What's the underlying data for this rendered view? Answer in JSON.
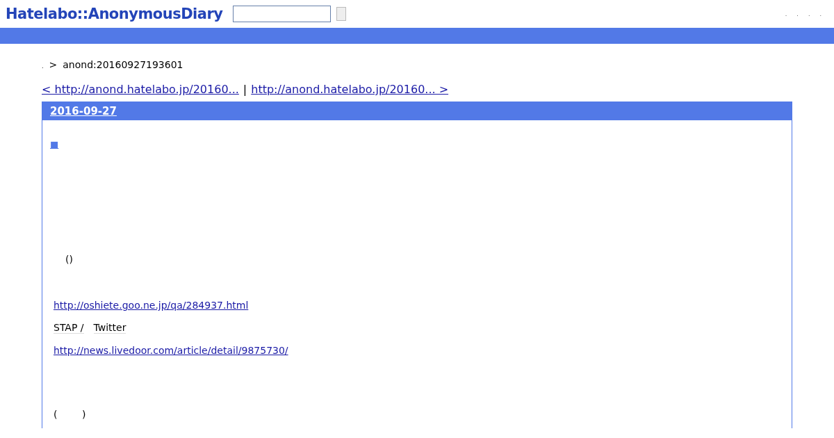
{
  "header": {
    "logo": "Hatelabo::AnonymousDiary",
    "menu_links": [
      ".",
      ".",
      ".",
      "."
    ]
  },
  "breadcrumb": {
    "home": ".",
    "separator": ">",
    "current": "anond:20160927193601"
  },
  "pager": {
    "prev": "< http://anond.hatelabo.jp/20160...",
    "separator": "|",
    "next": "http://anond.hatelabo.jp/20160... >"
  },
  "entry": {
    "date": "2016-09-27",
    "title_mark": "■",
    "lines": [
      {
        "kind": "text",
        "text": "()"
      },
      {
        "kind": "link",
        "text": "http://oshiete.goo.ne.jp/qa/284937.html"
      },
      {
        "kind": "keywords",
        "items": [
          "STAP /",
          "Twitter"
        ]
      },
      {
        "kind": "link",
        "text": "http://news.livedoor.com/article/detail/9875730/"
      },
      {
        "kind": "text",
        "text": "(        )"
      }
    ]
  }
}
